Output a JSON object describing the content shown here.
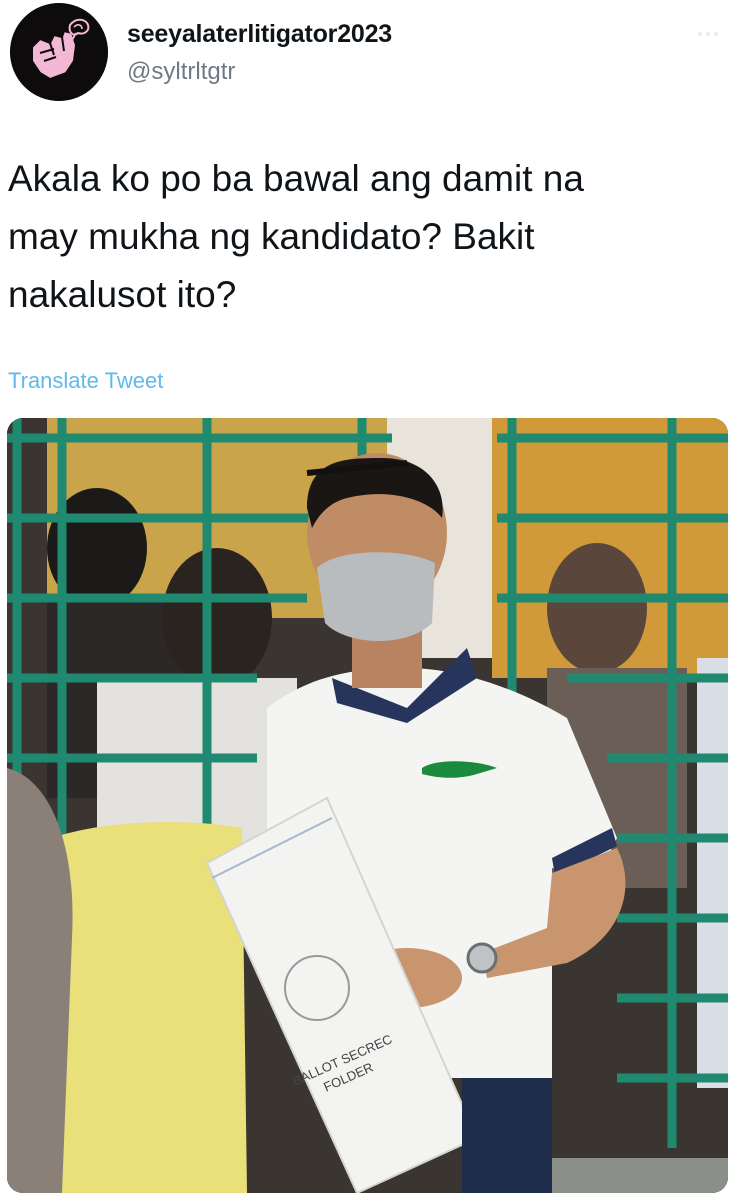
{
  "tweet": {
    "author": {
      "display_name": "seeyalaterlitigator2023",
      "handle": "@syltrltgtr",
      "avatar_icon": "raised-fist-with-rose-icon"
    },
    "text": "Akala ko po ba bawal ang damit na\nmay mukha ng kandidato? Bakit\nnakalusot ito?",
    "translate_label": "Translate Tweet",
    "more_icon": "ellipsis-icon",
    "media": {
      "folder_lines": [
        "BALLOT SECREC",
        "FOLDER"
      ]
    }
  },
  "colors": {
    "link": "#5fb9ec",
    "handle": "#6e7a85",
    "avatar_bg": "#0d0b0c",
    "avatar_accent": "#f3b8d4"
  }
}
